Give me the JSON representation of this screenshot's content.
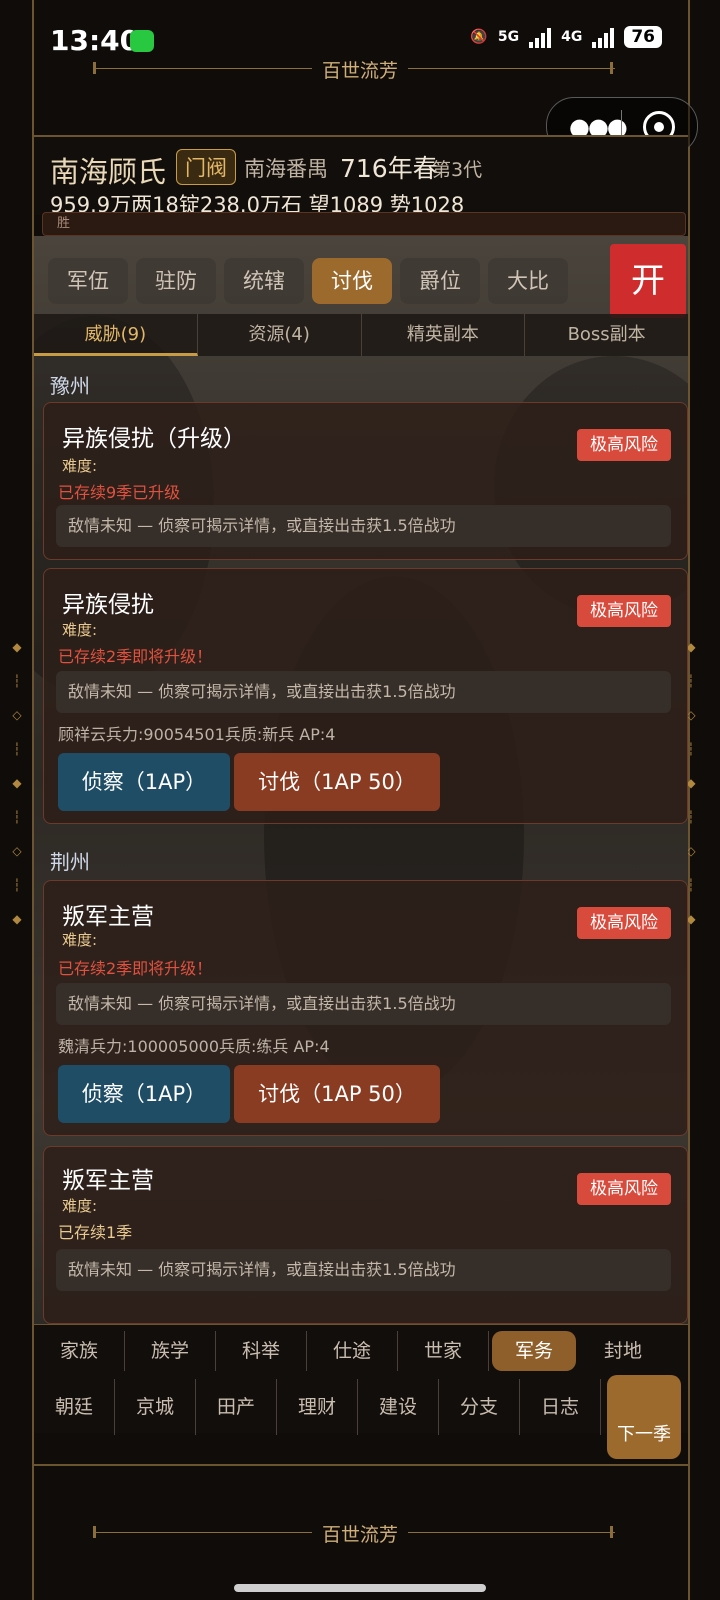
{
  "status_bar": {
    "time": "13:40",
    "signal1": "5G",
    "signal2": "4G",
    "battery": "76"
  },
  "app_title": "百世流芳",
  "header": {
    "family": "南海顾氏",
    "family_rank": "门阀",
    "place": "南海番禺",
    "year": "716年春",
    "generation": "第3代",
    "resources": "959.9万两18锭238.0万石  望1089 势1028",
    "notice": "胜"
  },
  "main_tabs": [
    "军伍",
    "驻防",
    "统辖",
    "讨伐",
    "爵位",
    "大比"
  ],
  "open_button": "开",
  "sub_tabs": [
    "威胁(9)",
    "资源(4)",
    "精英副本",
    "Boss副本"
  ],
  "regions": [
    "豫州",
    "荆州"
  ],
  "cards": [
    {
      "title": "异族侵扰（升级）",
      "risk": "极高风险",
      "difficulty": "难度:",
      "status": "已存续9季已升级",
      "intel": "敌情未知 — 侦察可揭示详情，或直接出击获1.5倍战功"
    },
    {
      "title": "异族侵扰",
      "risk": "极高风险",
      "difficulty": "难度:",
      "status": "已存续2季即将升级！",
      "intel": "敌情未知 — 侦察可揭示详情，或直接出击获1.5倍战功",
      "troops": "顾祥云兵力:90054501兵质:新兵 AP:4",
      "scout": "侦察（1AP）",
      "attack": "讨伐（1AP 50）"
    },
    {
      "title": "叛军主营",
      "risk": "极高风险",
      "difficulty": "难度:",
      "status": "已存续2季即将升级！",
      "intel": "敌情未知 — 侦察可揭示详情，或直接出击获1.5倍战功",
      "troops": "魏清兵力:100005000兵质:练兵 AP:4",
      "scout": "侦察（1AP）",
      "attack": "讨伐（1AP 50）"
    },
    {
      "title": "叛军主营",
      "risk": "极高风险",
      "difficulty": "难度:",
      "status": "已存续1季",
      "intel": "敌情未知 — 侦察可揭示详情，或直接出击获1.5倍战功"
    }
  ],
  "bottom_nav": {
    "row1": [
      "家族",
      "族学",
      "科举",
      "仕途",
      "世家",
      "军务",
      "封地"
    ],
    "row2": [
      "朝廷",
      "京城",
      "田产",
      "理财",
      "建设",
      "分支",
      "日志"
    ],
    "next_season": "下一季"
  },
  "footer_title": "百世流芳"
}
